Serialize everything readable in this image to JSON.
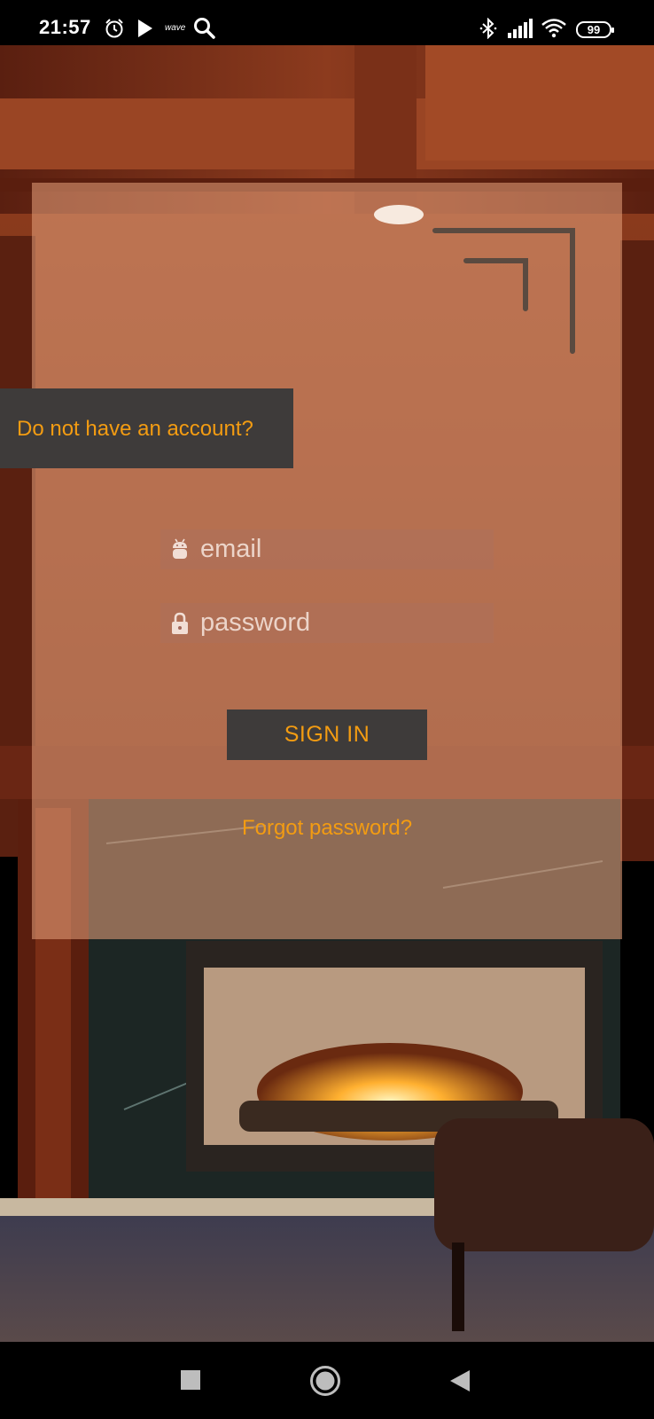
{
  "status_bar": {
    "time": "21:57",
    "icons_left": [
      "alarm-icon",
      "play-icon",
      "wave-icon",
      "search-icon"
    ],
    "wave_label": "wave",
    "icons_right": [
      "bluetooth-icon",
      "signal-icon",
      "wifi-icon",
      "battery-icon"
    ],
    "battery_level": "99"
  },
  "background": {
    "description_icon": "fireplace-room-photo"
  },
  "login": {
    "signup_prompt": "Do not have an account?",
    "email_placeholder": "email",
    "password_placeholder": "password",
    "sign_in_label": "SIGN IN",
    "forgot_password_label": "Forgot password?"
  },
  "nav_bar": {
    "buttons": [
      "recents-square-icon",
      "home-circle-icon",
      "back-triangle-icon"
    ]
  },
  "colors": {
    "accent": "#f39c12",
    "dark_panel": "#3e3b3a",
    "card_overlay": "#e29c78"
  }
}
